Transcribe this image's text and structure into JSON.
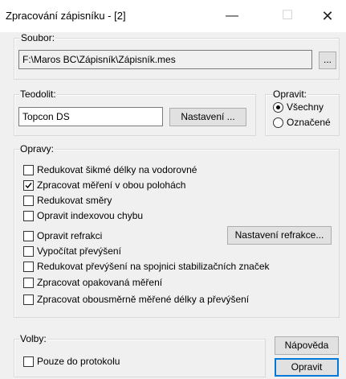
{
  "window": {
    "title": "Zpracování zápisníku - [2]",
    "minimize_glyph": "—",
    "maximize_glyph": "☐",
    "close_glyph": "✕"
  },
  "soubor": {
    "label": "Soubor:",
    "path": "F:\\Maros BC\\Zápisník\\Zápisník.mes",
    "browse_label": "..."
  },
  "teodolit": {
    "label": "Teodolit:",
    "value": "Topcon DS",
    "settings_label": "Nastavení ..."
  },
  "opravit": {
    "label": "Opravit:",
    "options": [
      {
        "label": "Všechny",
        "selected": true
      },
      {
        "label": "Označené",
        "selected": false
      }
    ]
  },
  "opravy": {
    "label": "Opravy:",
    "items": [
      {
        "label": "Redukovat šikmé délky na vodorovné",
        "checked": false
      },
      {
        "label": "Zpracovat měření v obou polohách",
        "checked": true
      },
      {
        "label": "Redukovat směry",
        "checked": false
      },
      {
        "label": "Opravit indexovou chybu",
        "checked": false
      },
      {
        "label": "Opravit refrakci",
        "checked": false
      },
      {
        "label": "Vypočítat převýšení",
        "checked": false
      },
      {
        "label": "Redukovat převýšení na spojnici stabilizačních značek",
        "checked": false
      },
      {
        "label": "Zpracovat opakovaná měření",
        "checked": false
      },
      {
        "label": "Zpracovat obousměrně měřené délky a převýšení",
        "checked": false
      }
    ],
    "refraction_settings_label": "Nastavení refrakce..."
  },
  "volby": {
    "label": "Volby:",
    "items": [
      {
        "label": "Pouze do protokolu",
        "checked": false
      }
    ]
  },
  "buttons": {
    "help_label": "Nápověda",
    "apply_label": "Opravit"
  }
}
